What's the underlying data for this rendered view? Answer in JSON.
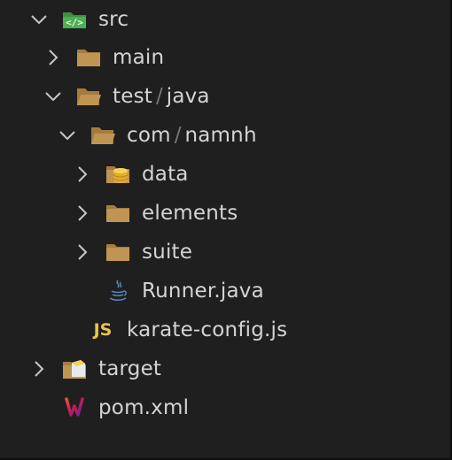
{
  "tree": {
    "src": {
      "label": "src",
      "icon": "folder-open-src-icon"
    },
    "main": {
      "label": "main",
      "icon": "folder-icon"
    },
    "test": {
      "label": "test",
      "sublabel": "java",
      "icon": "folder-open-icon"
    },
    "com": {
      "label": "com",
      "sublabel": "namnh",
      "icon": "folder-open-icon"
    },
    "data": {
      "label": "data",
      "icon": "database-folder-icon"
    },
    "elements": {
      "label": "elements",
      "icon": "folder-icon"
    },
    "suite": {
      "label": "suite",
      "icon": "folder-icon"
    },
    "runner": {
      "label": "Runner.java",
      "icon": "java-icon"
    },
    "karate": {
      "label": "karate-config.js",
      "icon": "js-icon",
      "icon_text": "JS"
    },
    "target": {
      "label": "target",
      "icon": "target-folder-icon"
    },
    "pom": {
      "label": "pom.xml",
      "icon": "maven-icon"
    }
  },
  "separator": "/",
  "colors": {
    "background": "#1f1f1f",
    "text": "#d4d4d4",
    "folder": "#c09553",
    "src_folder": "#4caf50",
    "js": "#e8c547"
  }
}
